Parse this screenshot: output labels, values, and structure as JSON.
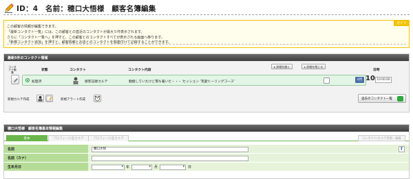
{
  "header": {
    "title": "ID：4　名前：穂口大悟様　顧客名簿編集"
  },
  "guide": {
    "badge": "ガイド",
    "lines": [
      "この顧客の情報が編集できます。",
      "「最新コンタクト一覧」には、この顧客との直近のコンタクトが最大５件表示されます。",
      "さらに「コンタクト一覧へ」を押すと、この顧客とのコンタクトすべてが表示される画面へ移ります。",
      "「新規コンタクト追加」を押すと、顧客情報とお店とのコンタクトを関連付けて記録することができます。"
    ]
  },
  "contacts": {
    "heading": "最新5件のコンタクト情報",
    "col_edit": "コンタクト編集",
    "col_status": "状態",
    "col_contact": "コンタクト",
    "col_content": "コンタクト内容",
    "col_date": "日時",
    "open_detail": "詳細を開く",
    "close_detail": "詳細を閉じる",
    "rows": [
      {
        "status": "処理済",
        "type": "接客記録カルテ",
        "content": "動揺していたけど落ち着いた・・・ セッション '克愛ヒーリングコース'",
        "month": "4月",
        "day": "10",
        "time": "10:00:00"
      }
    ],
    "new_chart": "新規カルテ作成",
    "new_alert": "新規アラート作成",
    "list_button": "過去のコンタクト一覧"
  },
  "basic": {
    "heading": "穂口大悟様　顧客名簿基本情報編集",
    "tab_basic": "基本",
    "tab_profile_chart": "プロフィール型カルテ",
    "tab_profile_chart2": "プロフィール型カルテ",
    "tab_contact_list": "コンタクト/カルテ参照・編集",
    "label_name": "名前",
    "value_name": "穂口大悟",
    "label_kana": "名前（カナ）",
    "value_kana": "",
    "label_birth": "生年月日",
    "unit_year": "年",
    "unit_month": "月",
    "unit_day": "日",
    "facebook_glyph": "f"
  },
  "colors": {
    "accent_green": "#6bb54d",
    "label_green": "#b6dd98",
    "guide_yellow": "#f2c200",
    "row_green": "#e3f6e6",
    "month_blue": "#4b6fa8"
  }
}
